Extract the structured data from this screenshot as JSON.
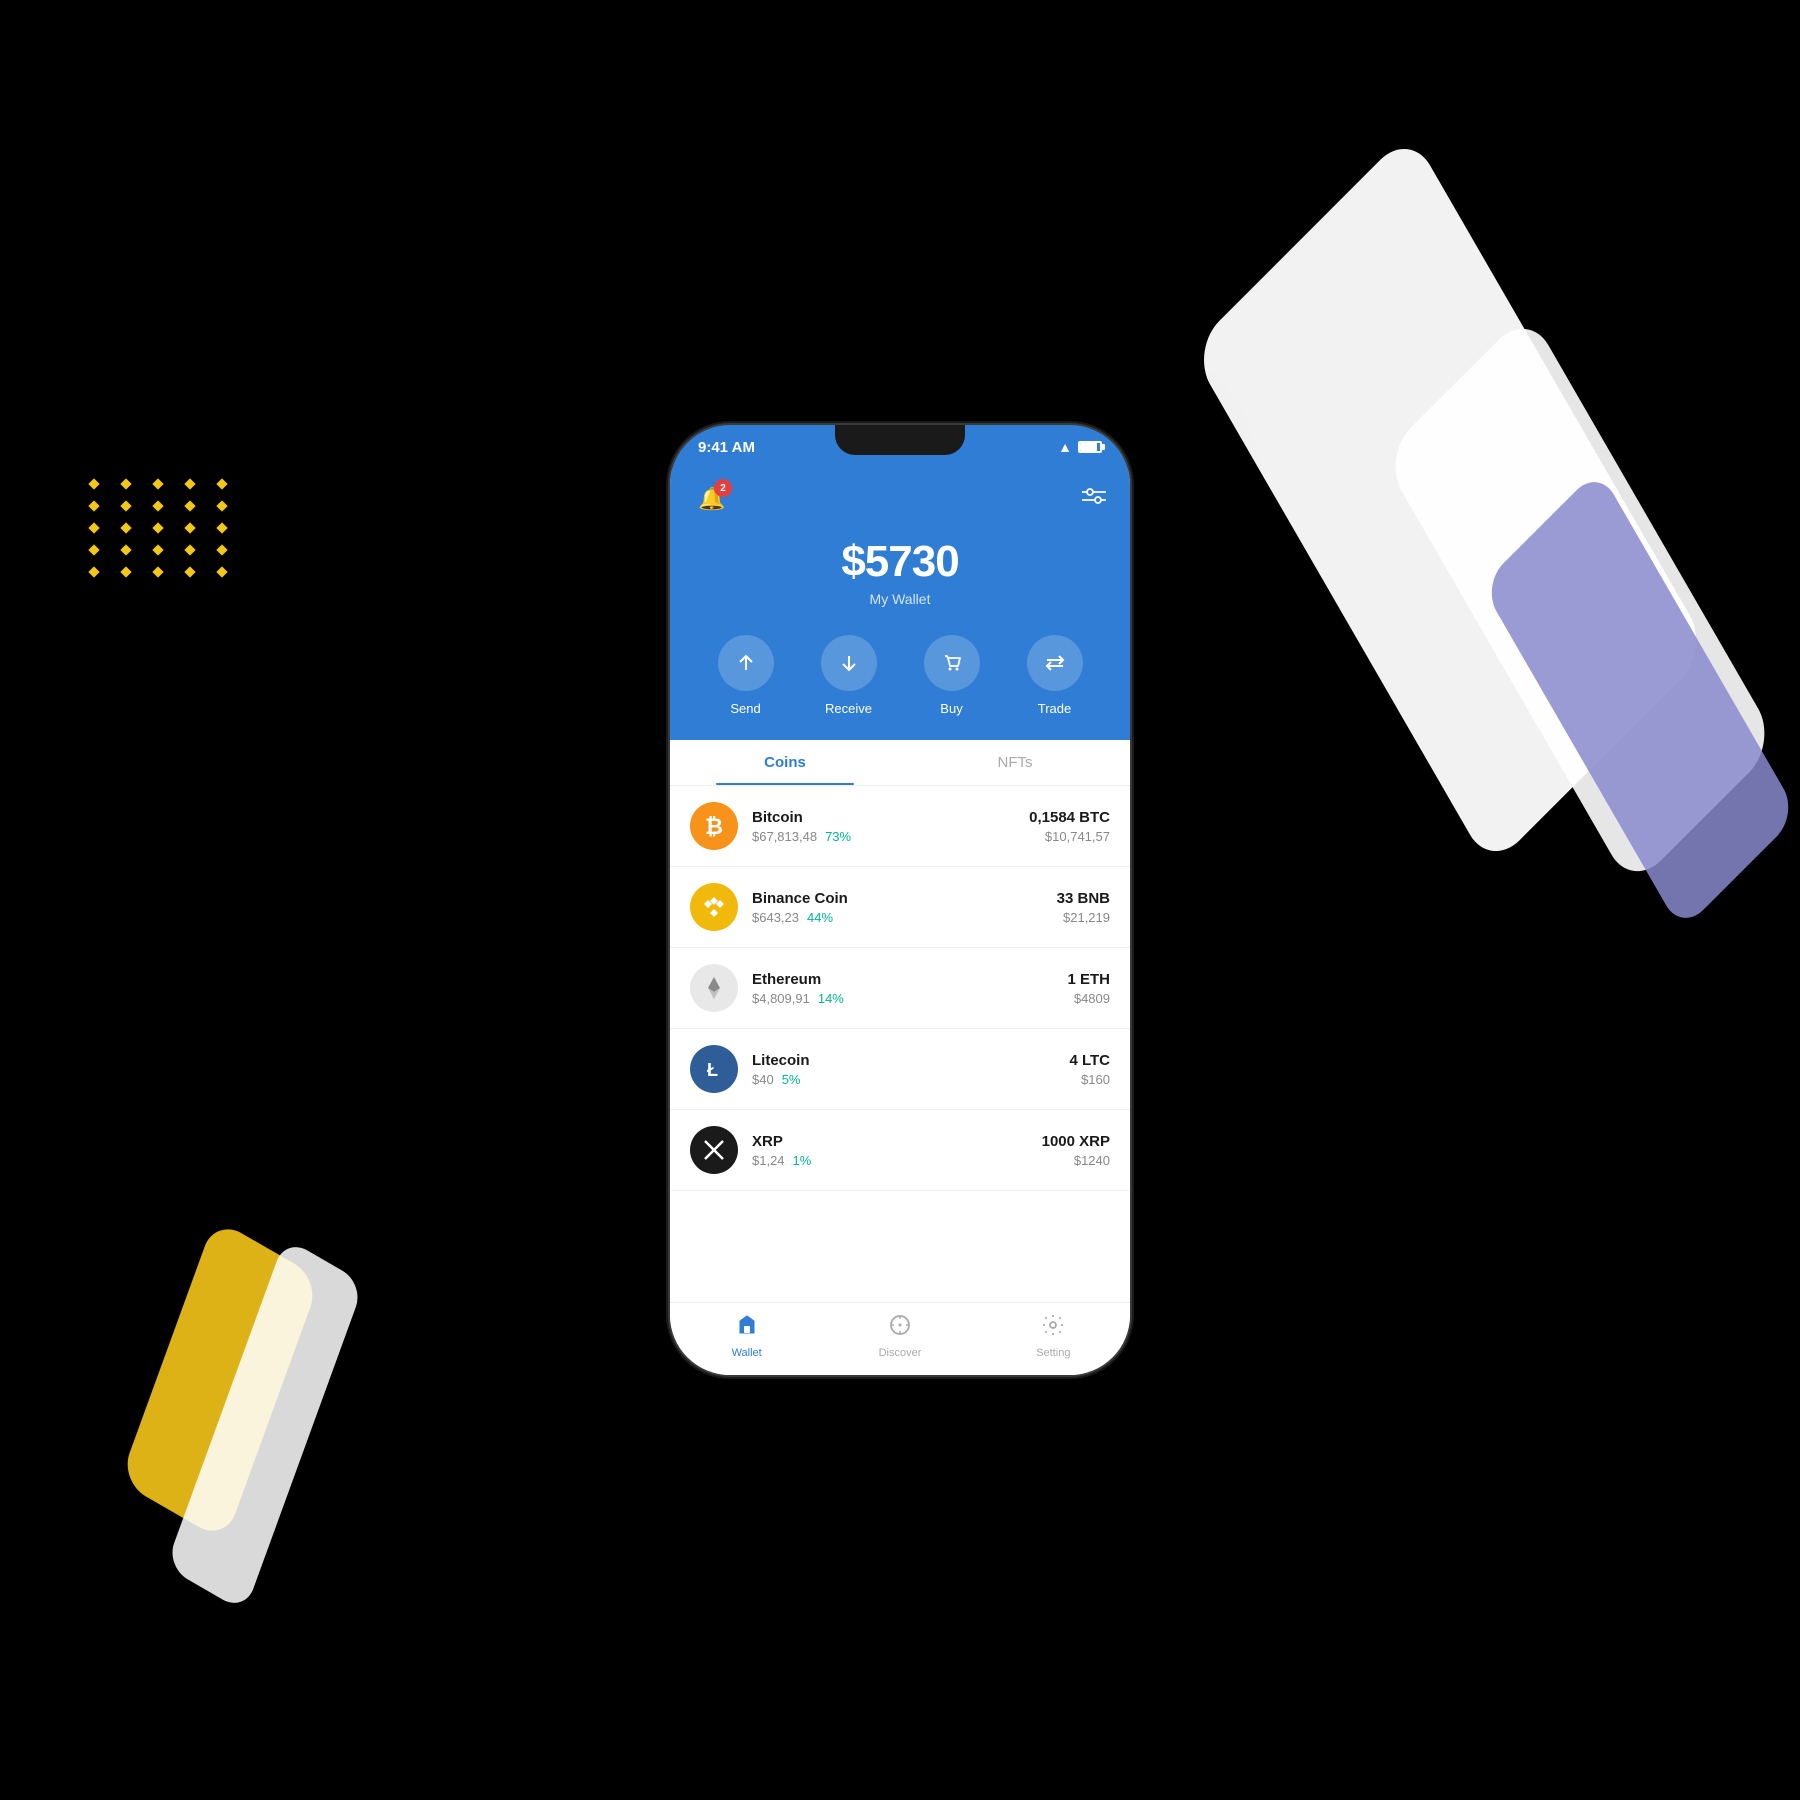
{
  "background": "#000000",
  "decorative": {
    "dots_color": "#f5c518"
  },
  "status_bar": {
    "time": "9:41 AM",
    "wifi": true,
    "battery_percent": 85
  },
  "header": {
    "notification_count": "2",
    "balance_amount": "$5730",
    "balance_label": "My Wallet",
    "actions": [
      {
        "id": "send",
        "label": "Send",
        "icon": "↑"
      },
      {
        "id": "receive",
        "label": "Receive",
        "icon": "↓"
      },
      {
        "id": "buy",
        "label": "Buy",
        "icon": "🏷"
      },
      {
        "id": "trade",
        "label": "Trade",
        "icon": "⇄"
      }
    ]
  },
  "tabs": [
    {
      "id": "coins",
      "label": "Coins",
      "active": true
    },
    {
      "id": "nfts",
      "label": "NFTs",
      "active": false
    }
  ],
  "coins": [
    {
      "id": "btc",
      "name": "Bitcoin",
      "price": "$67,813,48",
      "change": "73%",
      "amount": "0,1584 BTC",
      "value": "$10,741,57",
      "symbol": "₿",
      "color": "btc"
    },
    {
      "id": "bnb",
      "name": "Binance Coin",
      "price": "$643,23",
      "change": "44%",
      "amount": "33 BNB",
      "value": "$21,219",
      "symbol": "◈",
      "color": "bnb"
    },
    {
      "id": "eth",
      "name": "Ethereum",
      "price": "$4,809,91",
      "change": "14%",
      "amount": "1 ETH",
      "value": "$4809",
      "symbol": "◆",
      "color": "eth"
    },
    {
      "id": "ltc",
      "name": "Litecoin",
      "price": "$40",
      "change": "5%",
      "amount": "4 LTC",
      "value": "$160",
      "symbol": "Ł",
      "color": "ltc"
    },
    {
      "id": "xrp",
      "name": "XRP",
      "price": "$1,24",
      "change": "1%",
      "amount": "1000 XRP",
      "value": "$1240",
      "symbol": "✕",
      "color": "xrp"
    }
  ],
  "bottom_nav": [
    {
      "id": "wallet",
      "label": "Wallet",
      "icon": "🛡",
      "active": true
    },
    {
      "id": "discover",
      "label": "Discover",
      "icon": "🧭",
      "active": false
    },
    {
      "id": "setting",
      "label": "Setting",
      "icon": "⚙",
      "active": false
    }
  ]
}
